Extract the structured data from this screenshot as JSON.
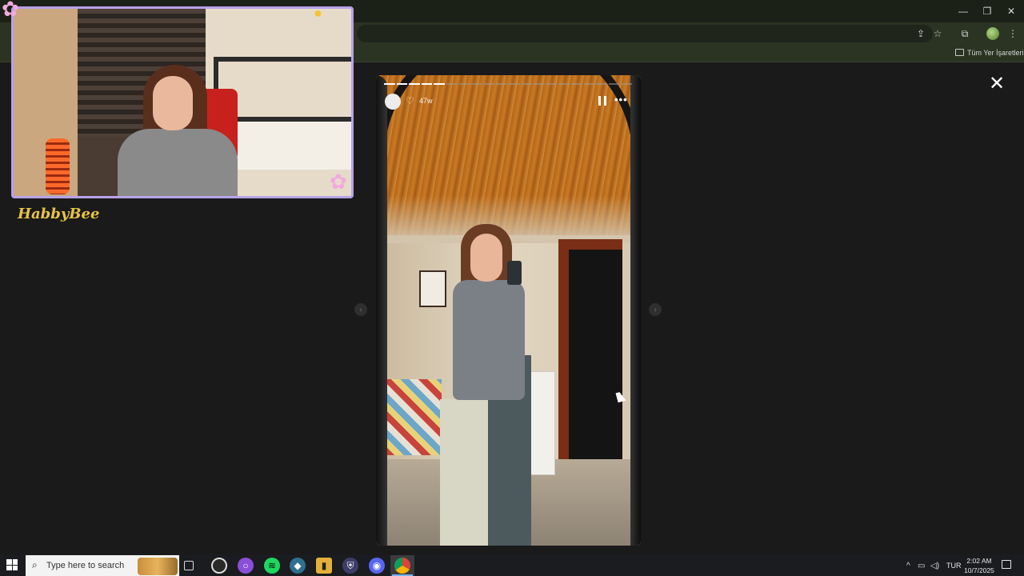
{
  "browser": {
    "bookmarks_label": "Tüm Yer İşaretleri",
    "window_controls": {
      "minimize": "—",
      "restore": "❐",
      "close": "✕"
    }
  },
  "story": {
    "time_ago": "47w",
    "segments_total": 20,
    "segments_done": 5,
    "close_glyph": "✕",
    "more_glyph": "•••",
    "heart_glyph": "♡",
    "prev_glyph": "‹",
    "next_glyph": "›"
  },
  "webcam": {
    "streamer_name": "HabbyBee"
  },
  "taskbar": {
    "search_placeholder": "Type here to search",
    "language": "TUR",
    "time": "2:02 AM",
    "date": "10/7/2025",
    "chevron": "^",
    "pinned_icons": [
      "task-view-icon",
      "obs-icon",
      "cortana-icon",
      "spotify-icon",
      "app-icon",
      "fl-studio-icon",
      "shield-icon",
      "discord-icon",
      "chrome-icon"
    ]
  },
  "colors": {
    "accent_webcam_border": "#b6a2e8",
    "streamer_name": "#e8c349",
    "taskbar_active_underline": "#74b3f3"
  }
}
